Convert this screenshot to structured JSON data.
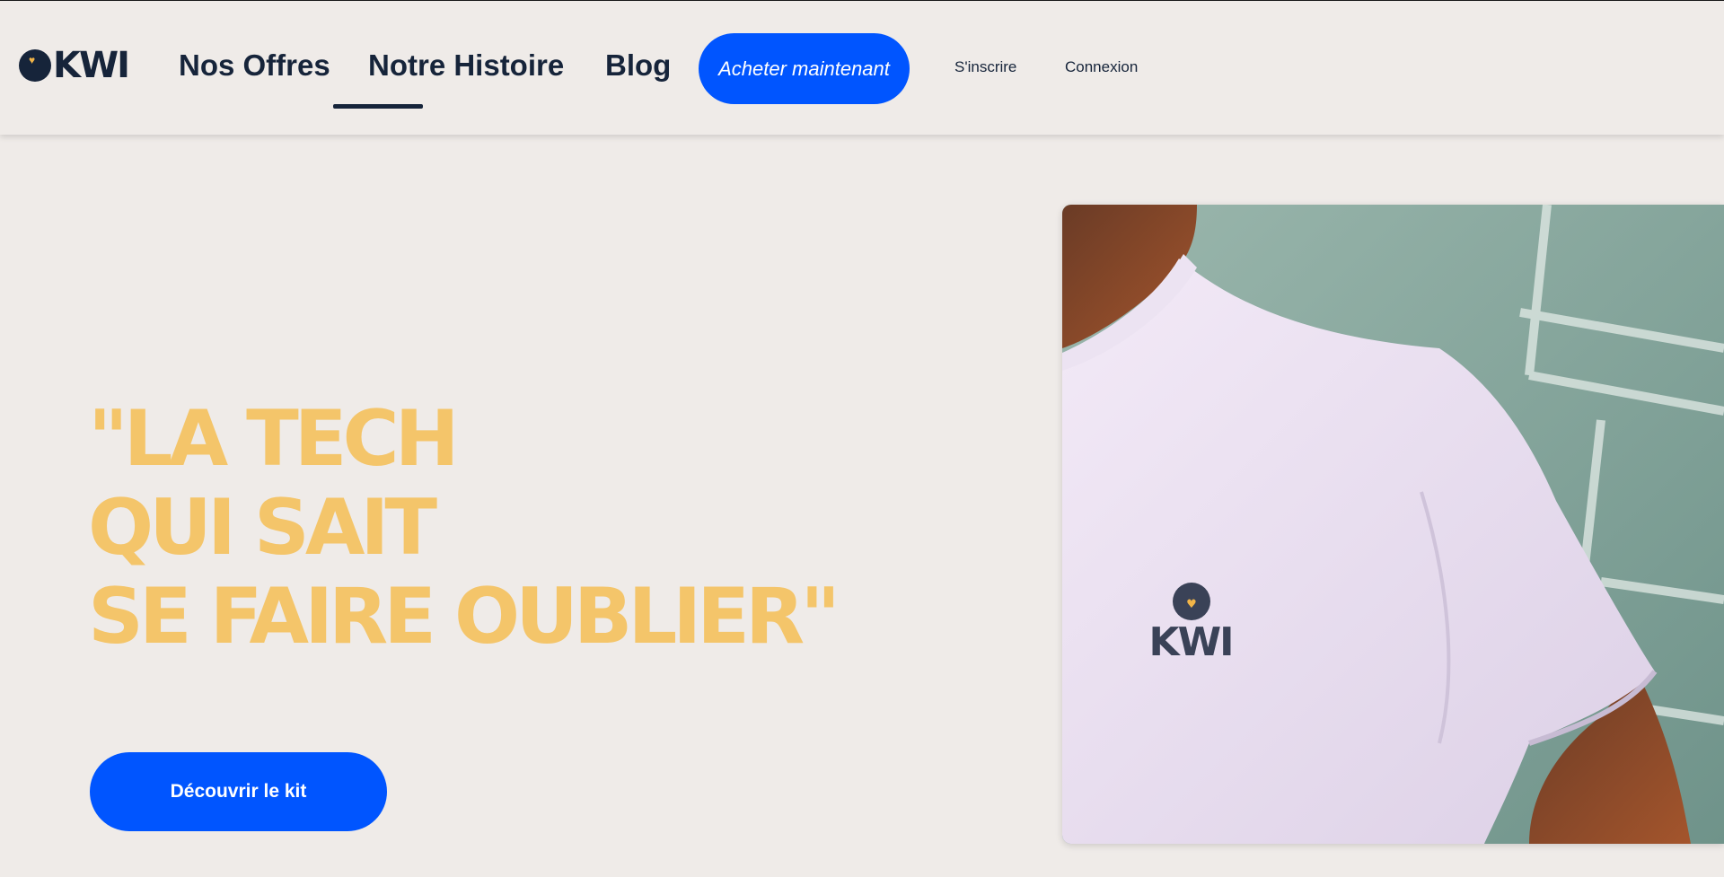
{
  "header": {
    "logo_text": "KWI",
    "nav": [
      {
        "label": "Nos Offres"
      },
      {
        "label": "Notre Histoire"
      },
      {
        "label": "Blog"
      }
    ],
    "buy_button": "Acheter maintenant",
    "signup": "S'inscrire",
    "login": "Connexion",
    "active_nav": "Notre Histoire"
  },
  "hero": {
    "headline_lines": [
      "\"LA TECH",
      "QUI SAIT",
      "SE FAIRE OUBLIER\""
    ],
    "cta_label": "Découvrir le kit",
    "image_logo_text": "KWI"
  },
  "icons": [
    "kwi-logo-icon",
    "heart-icon"
  ],
  "colors": {
    "background": "#efebe8",
    "primary_blue": "#0055ff",
    "navy": "#16243a",
    "headline_yellow": "#f4c56a"
  }
}
